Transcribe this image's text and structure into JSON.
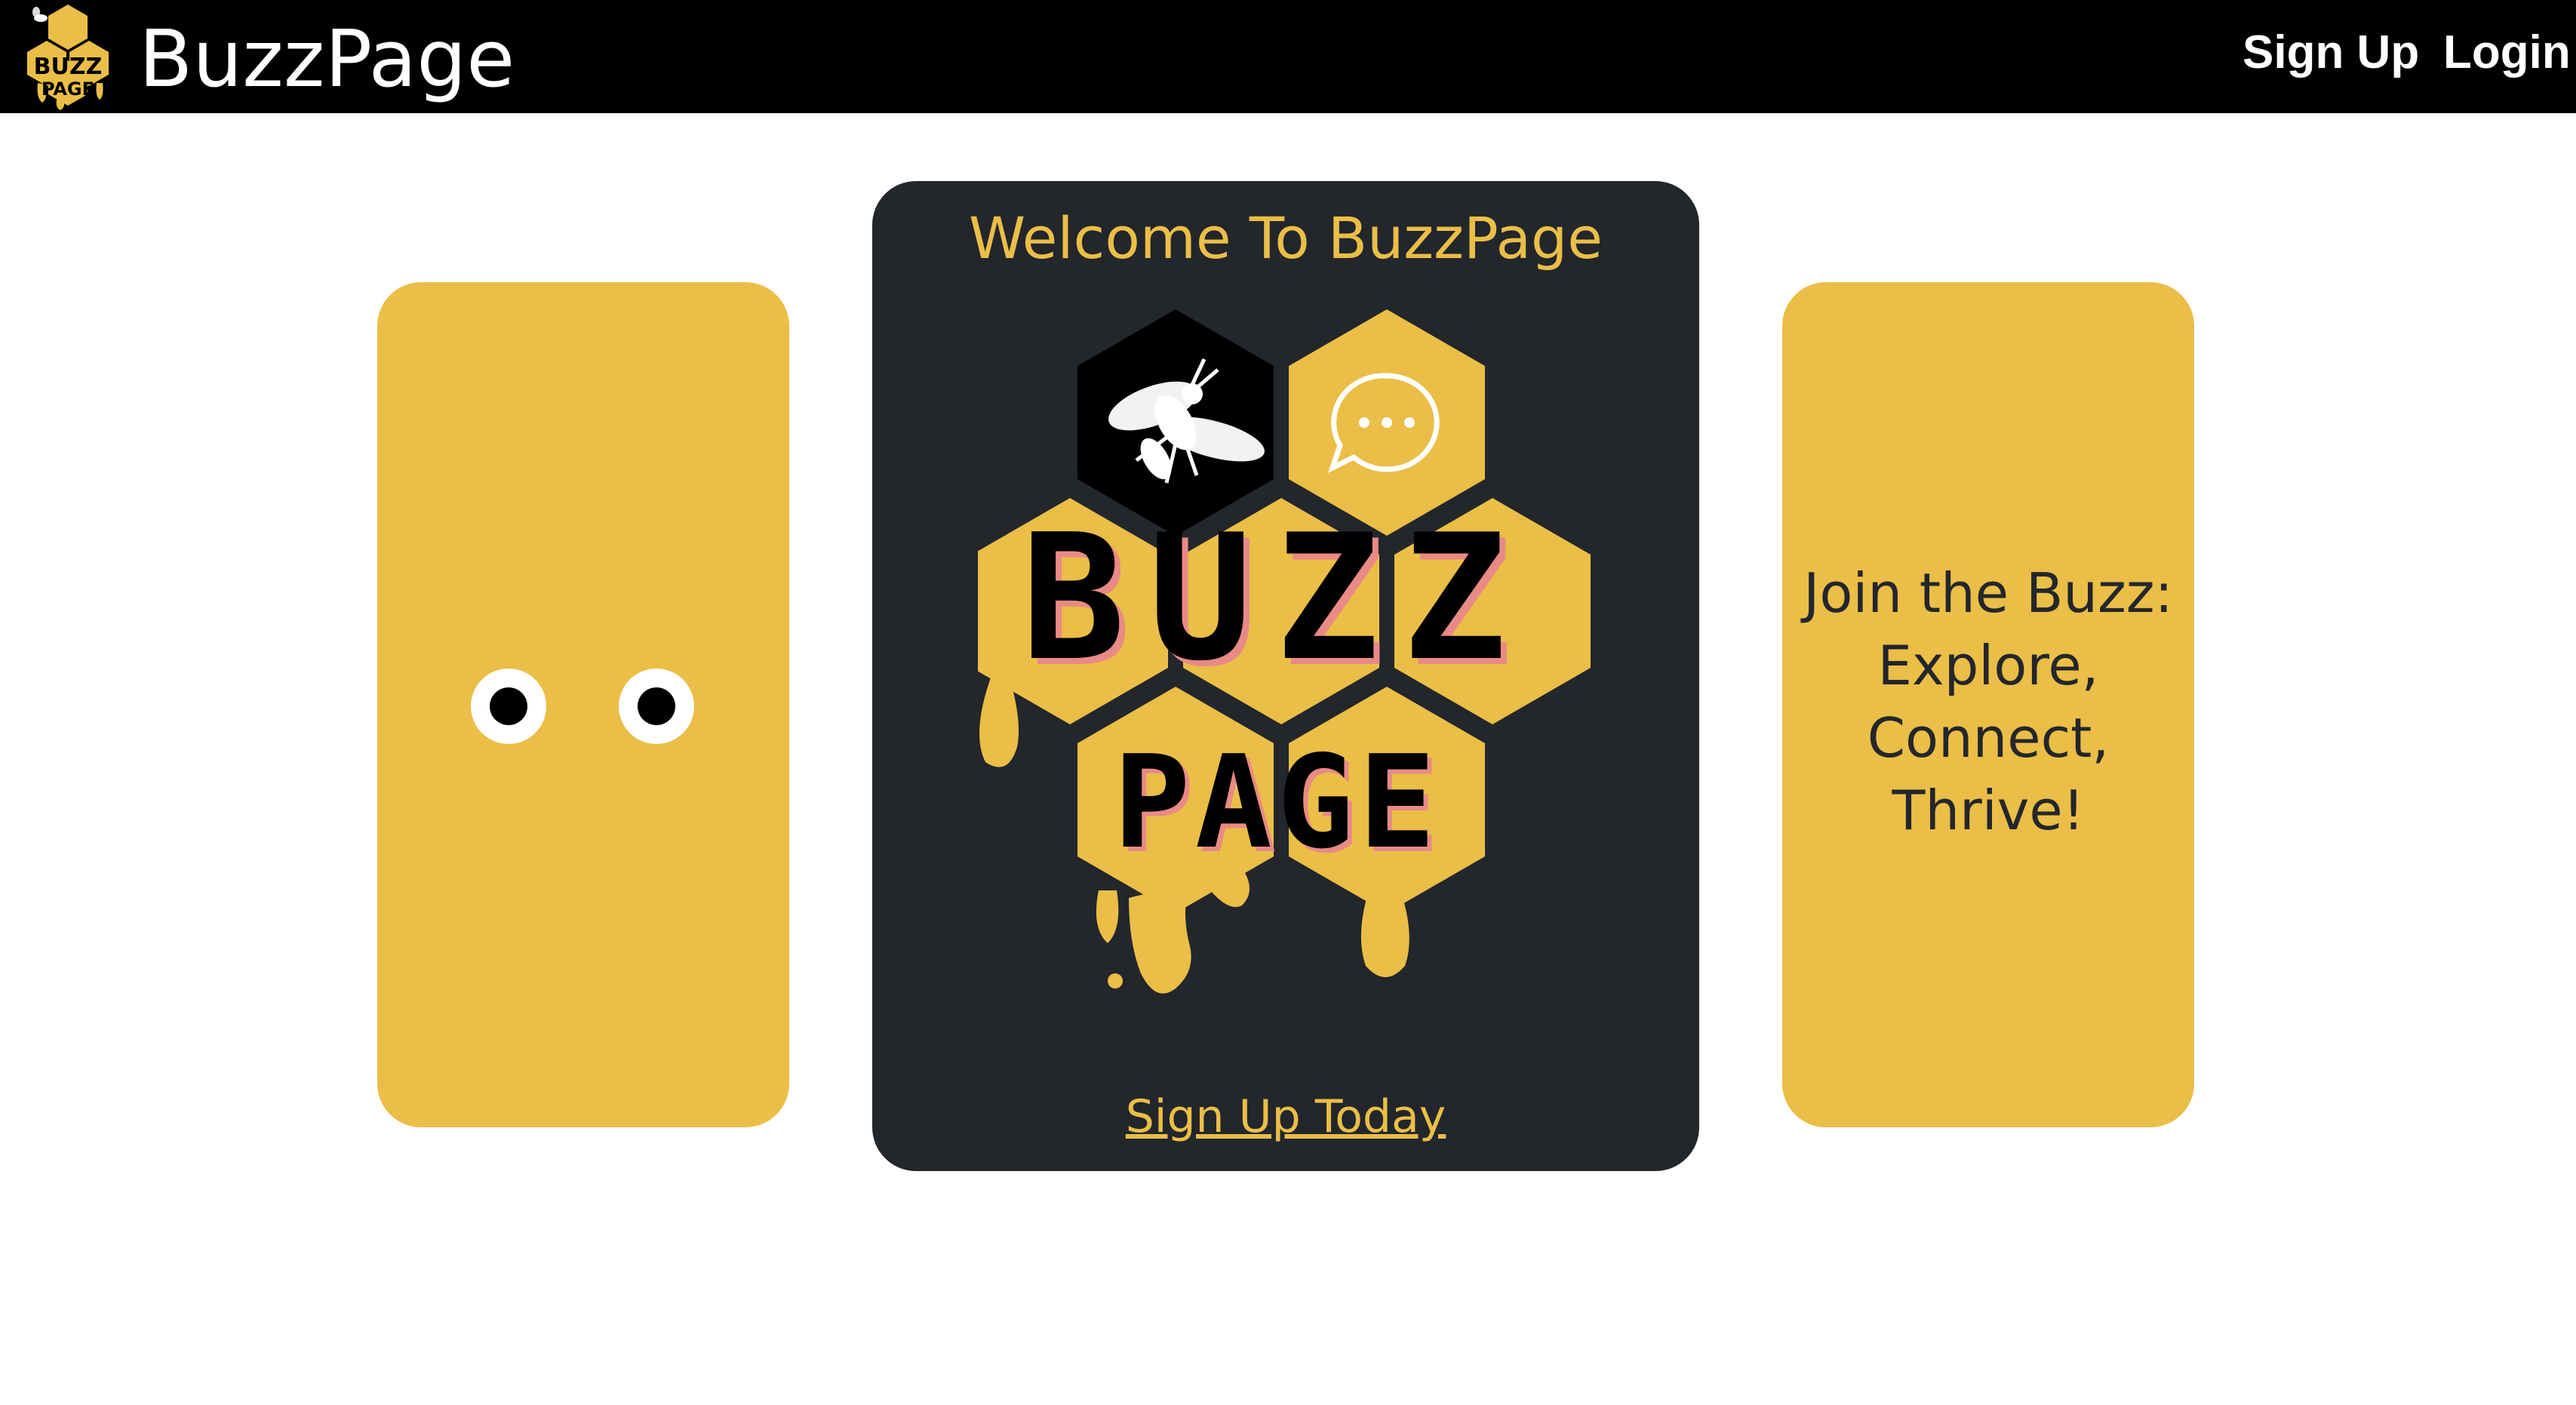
{
  "navbar": {
    "brand_name": "BuzzPage",
    "logo_icon": "buzzpage-logo-icon",
    "links": {
      "signup": "Sign Up",
      "login": "Login"
    }
  },
  "hero": {
    "welcome_title": "Welcome To BuzzPage",
    "logo_icon": "buzzpage-honeycomb-logo",
    "logo_text_top": "BUZZ",
    "logo_text_bottom": "PAGE",
    "signup_link": "Sign Up Today"
  },
  "eyes_card": {
    "icon": "googly-eyes-icon"
  },
  "tagline_card": {
    "lines": [
      "Join the Buzz:",
      "Explore,",
      "Connect,",
      "Thrive!"
    ]
  },
  "colors": {
    "honey": "#eabe47",
    "dark": "#23262b",
    "black": "#000000",
    "white": "#ffffff",
    "shadow_pink": "#e98a86"
  }
}
